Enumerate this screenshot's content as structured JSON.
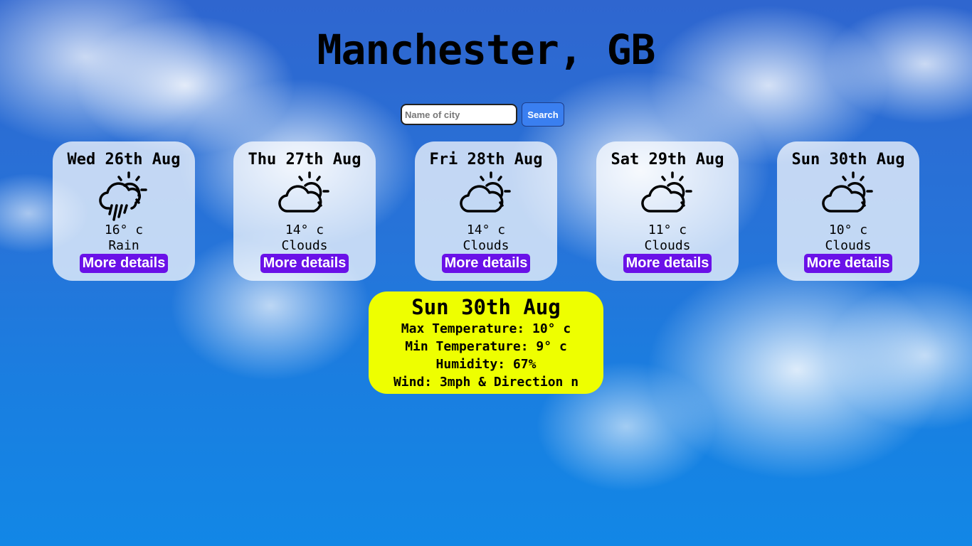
{
  "header": {
    "city_title": "Manchester, GB"
  },
  "search": {
    "placeholder": "Name of city",
    "value": "",
    "button_label": "Search"
  },
  "forecast": [
    {
      "day": "Wed 26th Aug",
      "temp": "16° c",
      "condition": "Rain",
      "icon": "rain-sun-icon",
      "button_label": "More details"
    },
    {
      "day": "Thu 27th Aug",
      "temp": "14° c",
      "condition": "Clouds",
      "icon": "cloud-sun-icon",
      "button_label": "More details"
    },
    {
      "day": "Fri 28th Aug",
      "temp": "14° c",
      "condition": "Clouds",
      "icon": "cloud-sun-icon",
      "button_label": "More details"
    },
    {
      "day": "Sat 29th Aug",
      "temp": "11° c",
      "condition": "Clouds",
      "icon": "cloud-sun-icon",
      "button_label": "More details"
    },
    {
      "day": "Sun 30th Aug",
      "temp": "10° c",
      "condition": "Clouds",
      "icon": "cloud-sun-icon",
      "button_label": "More details"
    }
  ],
  "details": {
    "day": "Sun 30th Aug",
    "max_temp": "Max Temperature: 10° c",
    "min_temp": "Min Temperature: 9° c",
    "humidity": "Humidity: 67%",
    "wind": "Wind: 3mph & Direction n"
  },
  "colors": {
    "details_button": "#6a11e8",
    "search_button": "#3a7ff0",
    "detail_panel": "#eeff00"
  }
}
